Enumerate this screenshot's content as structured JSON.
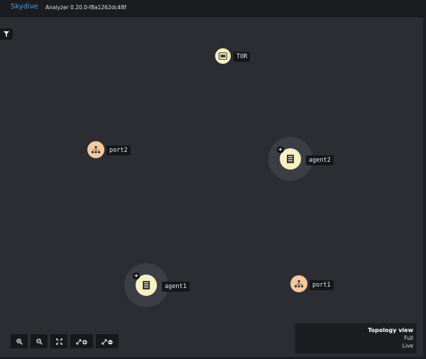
{
  "navbar": {
    "brand": "Skydive",
    "version": "Analyzer 0.20.0-f8a1262dc48f"
  },
  "toolbar": {
    "filter_icon": "filter-icon"
  },
  "nodes": [
    {
      "id": "tor",
      "label": "TOR",
      "kind": "switch",
      "icon": "switch-icon"
    },
    {
      "id": "agent2",
      "label": "agent2",
      "kind": "host",
      "icon": "server-icon",
      "expandable": true
    },
    {
      "id": "port2",
      "label": "port2",
      "kind": "port",
      "icon": "network-icon"
    },
    {
      "id": "agent1",
      "label": "agent1",
      "kind": "host",
      "icon": "server-icon",
      "expandable": true
    },
    {
      "id": "port1",
      "label": "port1",
      "kind": "port",
      "icon": "network-icon"
    }
  ],
  "zoom_controls": [
    "zoom-in-icon",
    "zoom-out-icon",
    "fit-icon",
    "expand-all-icon",
    "collapse-all-icon"
  ],
  "legend": {
    "title": "Topology view",
    "mode": "Full",
    "state": "Live"
  },
  "colors": {
    "brand": "#4d9ed8",
    "host_node": "#f6f0c2",
    "port_node": "#f6c8a0",
    "background": "#2b2d33"
  }
}
